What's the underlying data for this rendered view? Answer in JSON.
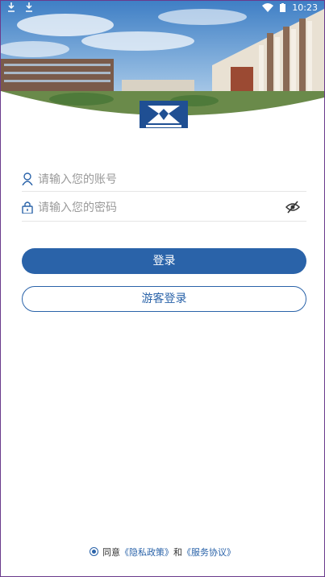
{
  "status_bar": {
    "time": "10:23",
    "icons": [
      "download-icon",
      "download-icon",
      "wifi-icon",
      "battery-icon"
    ]
  },
  "login_form": {
    "account_placeholder": "请输入您的账号",
    "password_placeholder": "请输入您的密码"
  },
  "buttons": {
    "login_label": "登录",
    "guest_login_label": "游客登录"
  },
  "agreement": {
    "prefix": "同意",
    "privacy_link": "《隐私政策》",
    "conjunction": "和",
    "service_link": "《服务协议》"
  },
  "colors": {
    "primary": "#2a63a9",
    "placeholder": "#9a9a9a",
    "divider": "#e6e6e6"
  }
}
